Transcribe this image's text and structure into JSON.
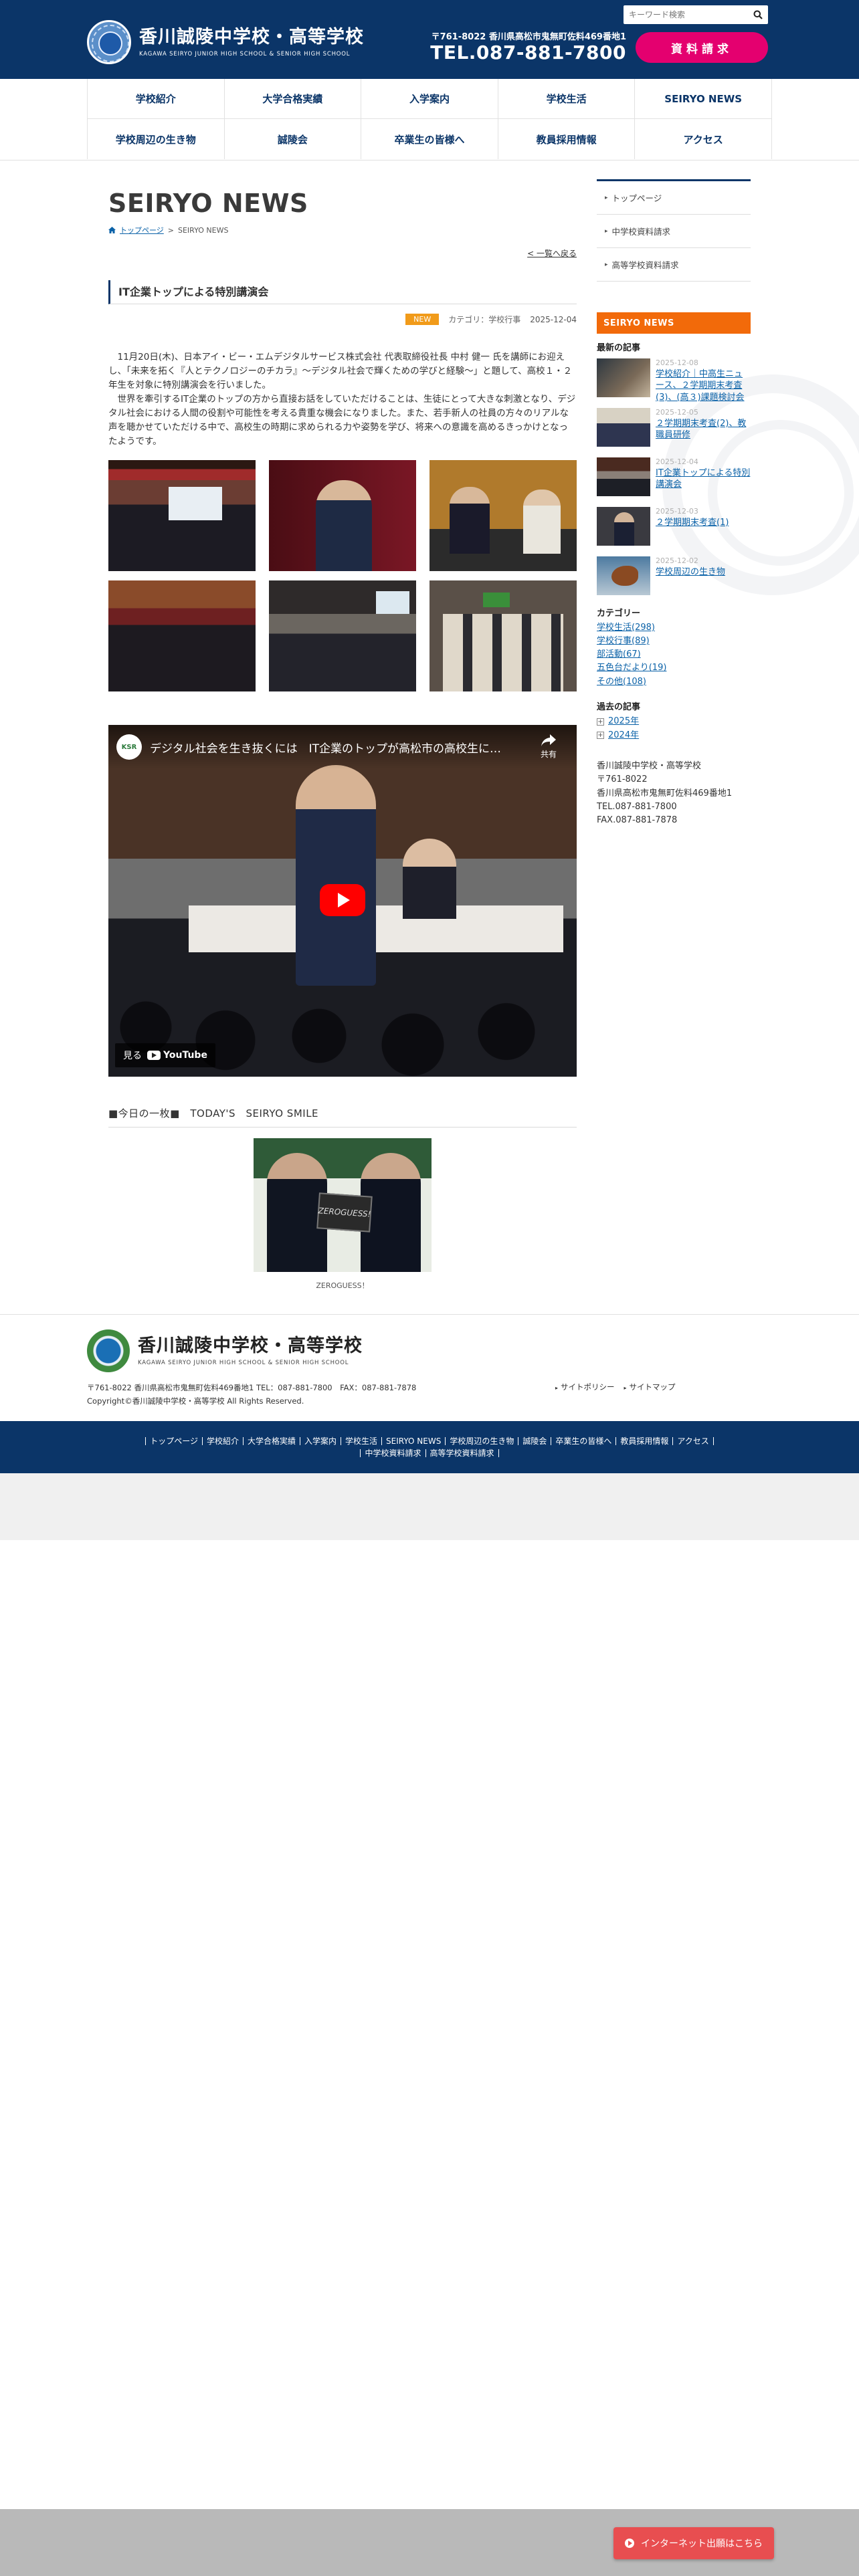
{
  "header": {
    "school_name": "香川誠陵中学校・高等学校",
    "school_name_en": "KAGAWA SEIRYO JUNIOR HIGH SCHOOL & SENIOR HIGH SCHOOL",
    "search_placeholder": "キーワード検索",
    "address": "〒761-8022 香川県高松市鬼無町佐料469番地1",
    "tel": "TEL.087-881-7800",
    "request_button": "資料請求"
  },
  "nav": {
    "row1": [
      "学校紹介",
      "大学合格実績",
      "入学案内",
      "学校生活",
      "SEIRYO NEWS"
    ],
    "row2": [
      "学校周辺の生き物",
      "誠陵会",
      "卒業生の皆様へ",
      "教員採用情報",
      "アクセス"
    ]
  },
  "main": {
    "page_title": "SEIRYO NEWS",
    "breadcrumb_home": "トップページ",
    "breadcrumb_sep": ">",
    "breadcrumb_current": "SEIRYO NEWS",
    "back_link": "< 一覧へ戻る",
    "article_title": "IT企業トップによる特別講演会",
    "badge": "NEW",
    "category": "カテゴリ：学校行事",
    "date": "2025-12-04",
    "paragraphs": [
      "11月20日(木)、日本アイ・ビー・エムデジタルサービス株式会社 代表取締役社長 中村 健一 氏を講師にお迎えし、「未来を拓く『人とテクノロジーのチカラ』～デジタル社会で輝くための学びと経験～」と題して、高校１・２年生を対象に特別講演会を行いました。",
      "世界を牽引するIT企業のトップの方から直接お話をしていただけることは、生徒にとって大きな刺激となり、デジタル社会における人間の役割や可能性を考える貴重な機会になりました。また、若手新人の社員の方々のリアルな声を聴かせていただける中で、高校生の時期に求められる力や姿勢を学び、将来への意識を高めるきっかけとなったようです。"
    ],
    "video": {
      "channel": "KSR",
      "title": "デジタル社会を生き抜くには　IT企業のトップが高松市の高校生に…",
      "share": "共有",
      "watch_on": "見る",
      "youtube": "YouTube"
    },
    "smile_title": "■今日の一枚■　TODAY'S　SEIRYO SMILE",
    "smile_board": "ZEROGUESS!",
    "smile_caption": "ZEROGUESS！"
  },
  "sidebar": {
    "links": [
      "トップページ",
      "中学校資料請求",
      "高等学校資料請求"
    ],
    "news_header": "SEIRYO NEWS",
    "recent_label": "最新の記事",
    "recent": [
      {
        "date": "2025-12-08",
        "title": "学校紹介｜中高生ニュース、２学期期末考査(3)、(高３)課題検討会"
      },
      {
        "date": "2025-12-05",
        "title": "２学期期末考査(2)、教職員研修"
      },
      {
        "date": "2025-12-04",
        "title": "IT企業トップによる特別講演会"
      },
      {
        "date": "2025-12-03",
        "title": "２学期期末考査(1)"
      },
      {
        "date": "2025-12-02",
        "title": "学校周辺の生き物"
      }
    ],
    "category_label": "カテゴリー",
    "categories": [
      "学校生活(298)",
      "学校行事(89)",
      "部活動(67)",
      "五色台だより(19)",
      "その他(108)"
    ],
    "archive_label": "過去の記事",
    "archives": [
      "2025年",
      "2024年"
    ],
    "address_lines": [
      "香川誠陵中学校・高等学校",
      "〒761-8022",
      "香川県高松市鬼無町佐料469番地1",
      "TEL.087-881-7800",
      "FAX.087-881-7878"
    ]
  },
  "footer": {
    "school_name": "香川誠陵中学校・高等学校",
    "school_name_en": "KAGAWA SEIRYO JUNIOR HIGH SCHOOL & SENIOR HIGH SCHOOL",
    "address": "〒761-8022 香川県高松市鬼無町佐料469番地1 TEL：087-881-7800　FAX：087-881-7878",
    "copyright": "Copyright©香川誠陵中学校・高等学校 All Rights Reserved.",
    "links": [
      "サイトポリシー",
      "サイトマップ"
    ],
    "nav_row1": [
      "トップページ",
      "学校紹介",
      "大学合格実績",
      "入学案内",
      "学校生活",
      "SEIRYO NEWS",
      "学校周辺の生き物",
      "誠陵会",
      "卒業生の皆様へ",
      "教員採用情報",
      "アクセス"
    ],
    "nav_row2": [
      "中学校資料請求",
      "高等学校資料請求"
    ],
    "apply_button": "インターネット出願はこちら"
  },
  "colors": {
    "navy": "#0b3568",
    "pink": "#e4006f",
    "orange": "#f26a0a",
    "badge": "#f19b1a",
    "link": "#0b62a8"
  }
}
